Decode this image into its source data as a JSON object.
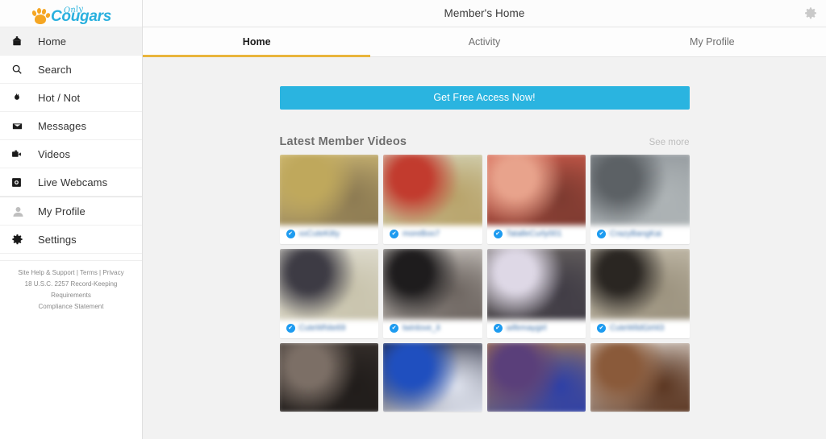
{
  "sidebar": {
    "logo": {
      "word_top": "Only",
      "word_main": "Cougars",
      "icon": "paw-print-icon"
    },
    "items": [
      {
        "label": "Home",
        "icon": "home-icon",
        "active": true,
        "dim": false
      },
      {
        "label": "Search",
        "icon": "search-icon",
        "active": false,
        "dim": false
      },
      {
        "label": "Hot / Not",
        "icon": "flame-icon",
        "active": false,
        "dim": false
      },
      {
        "label": "Messages",
        "icon": "inbox-icon",
        "active": false,
        "dim": false
      },
      {
        "label": "Videos",
        "icon": "video-camera-icon",
        "active": false,
        "dim": false
      },
      {
        "label": "Live Webcams",
        "icon": "webcam-icon",
        "active": false,
        "dim": false
      },
      {
        "label": "My Profile",
        "icon": "person-icon",
        "active": false,
        "dim": true
      },
      {
        "label": "Settings",
        "icon": "gear-icon",
        "active": false,
        "dim": false
      }
    ],
    "footer": {
      "links": [
        "Site Help & Support",
        "Terms",
        "Privacy"
      ],
      "separator": " | ",
      "line2": "18 U.S.C. 2257 Record-Keeping Requirements",
      "line3": "Compliance Statement"
    }
  },
  "header": {
    "title": "Member's Home",
    "settings_icon": "gear-icon"
  },
  "tabs": [
    {
      "label": "Home",
      "active": true
    },
    {
      "label": "Activity",
      "active": false
    },
    {
      "label": "My Profile",
      "active": false
    }
  ],
  "main": {
    "cta_label": "Get Free Access Now!",
    "section_title": "Latest Member Videos",
    "see_more_label": "See more",
    "videos": [
      {
        "username": "xxCuteKitty",
        "verified": true,
        "tone_a": "#d8c27a",
        "tone_b": "#bfa85c",
        "tone_c": "#8c7a52"
      },
      {
        "username": "moreBoo7",
        "verified": true,
        "tone_a": "#d9dcc4",
        "tone_b": "#c23b2e",
        "tone_c": "#b8a36a"
      },
      {
        "username": "TatalleCurly001",
        "verified": true,
        "tone_a": "#d9604f",
        "tone_b": "#e8a38c",
        "tone_c": "#7c3a30"
      },
      {
        "username": "CrazyBangKai",
        "verified": true,
        "tone_a": "#8e9499",
        "tone_b": "#5c6165",
        "tone_c": "#aeb4b6"
      },
      {
        "username": "CuteWhite69",
        "verified": true,
        "tone_a": "#e6e4da",
        "tone_b": "#3d3b44",
        "tone_c": "#c8c3ac"
      },
      {
        "username": "twinlove_it",
        "verified": true,
        "tone_a": "#ddd9d4",
        "tone_b": "#1e1c1d",
        "tone_c": "#6d6560"
      },
      {
        "username": "wifemaygirl",
        "verified": true,
        "tone_a": "#6f6a66",
        "tone_b": "#ded8e6",
        "tone_c": "#403c45"
      },
      {
        "username": "CuteWildGirl43",
        "verified": true,
        "tone_a": "#cbc4b4",
        "tone_b": "#2a2622",
        "tone_c": "#9c937f"
      },
      {
        "username": "",
        "verified": false,
        "tone_a": "#3c3531",
        "tone_b": "#7c6f66",
        "tone_c": "#201c1a"
      },
      {
        "username": "",
        "verified": false,
        "tone_a": "#16182a",
        "tone_b": "#1f4fbf",
        "tone_c": "#dfe3ee"
      },
      {
        "username": "",
        "verified": false,
        "tone_a": "#c08a3e",
        "tone_b": "#5a3f7a",
        "tone_c": "#2c3fa8"
      },
      {
        "username": "",
        "verified": false,
        "tone_a": "#f0ece6",
        "tone_b": "#8a5a3a",
        "tone_c": "#5a3520"
      }
    ]
  },
  "colors": {
    "accent_cta": "#2ab4e0",
    "tab_underline": "#e9b53c",
    "brand_blue": "#29b0de",
    "brand_orange": "#f5a623",
    "verified_badge": "#1d9bf0"
  }
}
